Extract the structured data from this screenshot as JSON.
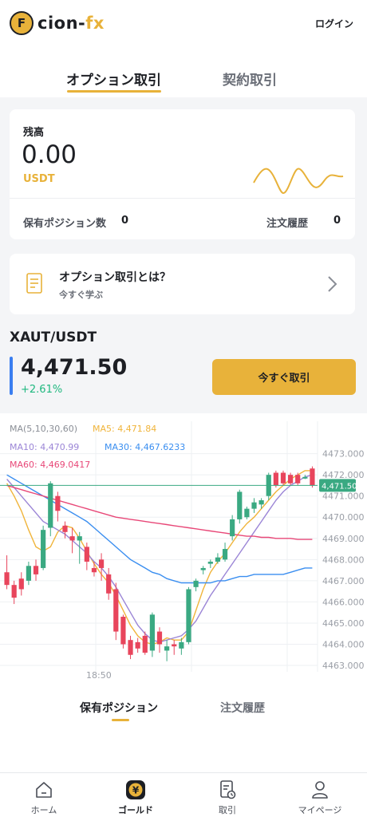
{
  "header": {
    "logo_mark": "F",
    "brand_main": "cion-",
    "brand_accent": "fx",
    "login_label": "ログイン"
  },
  "tabs": [
    {
      "label": "オプション取引",
      "active": true
    },
    {
      "label": "契約取引",
      "active": false
    }
  ],
  "balance": {
    "label": "残高",
    "value": "0.00",
    "unit": "USDT",
    "positions_label": "保有ポジション数",
    "positions_count": "0",
    "orders_label": "注文履歴",
    "orders_count": "0"
  },
  "learn": {
    "title": "オプション取引とは？",
    "subtitle": "今すぐ学ぶ",
    "icon": "document-icon"
  },
  "market": {
    "pair": "XAUT/USDT",
    "price": "4,471.50",
    "change": "+2.61%",
    "trade_label": "今すぐ取引"
  },
  "chart_data": {
    "type": "candlestick",
    "ma_legend": {
      "periods": "MA(5,10,30,60)",
      "ma5": "MA5: 4,471.84",
      "ma10": "MA10: 4,470.99",
      "ma30": "MA30: 4,467.6233",
      "ma60": "MA60: 4,469.0417"
    },
    "y_ticks": [
      4473.0,
      4472.0,
      4471.0,
      4470.0,
      4469.0,
      4468.0,
      4467.0,
      4466.0,
      4465.0,
      4464.0,
      4463.0
    ],
    "y_tick_labels": [
      "4473.000",
      "4472.000",
      "4471.000",
      "4470.000",
      "4469.000",
      "4468.000",
      "4467.000",
      "4466.000",
      "4465.000",
      "4464.000",
      "4463.000"
    ],
    "ylim": [
      4462.7,
      4473.4
    ],
    "x_label": "18:50",
    "current_price": 4471.5,
    "current_price_label": "4,471.50",
    "candles": [
      {
        "o": 4467.4,
        "h": 4468.2,
        "l": 4466.6,
        "c": 4466.8
      },
      {
        "o": 4466.8,
        "h": 4467.0,
        "l": 4465.9,
        "c": 4466.2
      },
      {
        "o": 4467.1,
        "h": 4467.4,
        "l": 4466.3,
        "c": 4466.6
      },
      {
        "o": 4467.0,
        "h": 4467.9,
        "l": 4466.8,
        "c": 4467.7
      },
      {
        "o": 4467.7,
        "h": 4468.0,
        "l": 4467.0,
        "c": 4467.3
      },
      {
        "o": 4467.6,
        "h": 4469.6,
        "l": 4467.5,
        "c": 4469.4
      },
      {
        "o": 4469.5,
        "h": 4471.7,
        "l": 4469.1,
        "c": 4471.6
      },
      {
        "o": 4471.0,
        "h": 4471.2,
        "l": 4469.8,
        "c": 4470.3
      },
      {
        "o": 4469.6,
        "h": 4469.8,
        "l": 4469.0,
        "c": 4469.3
      },
      {
        "o": 4469.1,
        "h": 4469.5,
        "l": 4468.3,
        "c": 4468.9
      },
      {
        "o": 4468.9,
        "h": 4469.3,
        "l": 4467.8,
        "c": 4469.1
      },
      {
        "o": 4468.6,
        "h": 4468.8,
        "l": 4467.5,
        "c": 4467.9
      },
      {
        "o": 4467.6,
        "h": 4467.9,
        "l": 4467.2,
        "c": 4467.4
      },
      {
        "o": 4468.0,
        "h": 4468.3,
        "l": 4467.0,
        "c": 4467.6
      },
      {
        "o": 4467.3,
        "h": 4467.6,
        "l": 4466.1,
        "c": 4466.4
      },
      {
        "o": 4466.6,
        "h": 4466.9,
        "l": 4464.2,
        "c": 4464.6
      },
      {
        "o": 4465.3,
        "h": 4465.4,
        "l": 4463.8,
        "c": 4464.0
      },
      {
        "o": 4464.2,
        "h": 4464.4,
        "l": 4463.3,
        "c": 4463.5
      },
      {
        "o": 4464.1,
        "h": 4464.3,
        "l": 4463.6,
        "c": 4463.8
      },
      {
        "o": 4464.4,
        "h": 4464.6,
        "l": 4463.5,
        "c": 4463.6
      },
      {
        "o": 4463.7,
        "h": 4465.5,
        "l": 4463.4,
        "c": 4465.4
      },
      {
        "o": 4464.6,
        "h": 4464.8,
        "l": 4463.6,
        "c": 4464.0
      },
      {
        "o": 4463.7,
        "h": 4464.2,
        "l": 4463.2,
        "c": 4463.9
      },
      {
        "o": 4464.0,
        "h": 4464.2,
        "l": 4463.5,
        "c": 4463.9
      },
      {
        "o": 4463.8,
        "h": 4464.3,
        "l": 4463.5,
        "c": 4464.1
      },
      {
        "o": 4464.1,
        "h": 4466.7,
        "l": 4464.0,
        "c": 4466.6
      },
      {
        "o": 4466.7,
        "h": 4467.1,
        "l": 4466.5,
        "c": 4467.0
      },
      {
        "o": 4467.5,
        "h": 4467.7,
        "l": 4467.3,
        "c": 4467.6
      },
      {
        "o": 4467.8,
        "h": 4468.0,
        "l": 4467.6,
        "c": 4467.9
      },
      {
        "o": 4467.9,
        "h": 4468.3,
        "l": 4467.8,
        "c": 4468.1
      },
      {
        "o": 4468.0,
        "h": 4468.8,
        "l": 4467.9,
        "c": 4468.5
      },
      {
        "o": 4469.1,
        "h": 4470.1,
        "l": 4468.9,
        "c": 4469.9
      },
      {
        "o": 4469.9,
        "h": 4471.3,
        "l": 4469.7,
        "c": 4471.2
      },
      {
        "o": 4470.0,
        "h": 4470.5,
        "l": 4469.9,
        "c": 4470.4
      },
      {
        "o": 4470.4,
        "h": 4470.9,
        "l": 4470.2,
        "c": 4470.7
      },
      {
        "o": 4470.6,
        "h": 4470.9,
        "l": 4470.4,
        "c": 4470.8
      },
      {
        "o": 4471.0,
        "h": 4472.1,
        "l": 4470.8,
        "c": 4472.0
      },
      {
        "o": 4472.1,
        "h": 4472.2,
        "l": 4471.4,
        "c": 4471.5
      },
      {
        "o": 4472.1,
        "h": 4472.2,
        "l": 4471.5,
        "c": 4471.6
      },
      {
        "o": 4472.0,
        "h": 4472.1,
        "l": 4471.5,
        "c": 4471.6
      },
      {
        "o": 4472.0,
        "h": 4472.1,
        "l": 4471.5,
        "c": 4471.6
      },
      {
        "o": 4471.9,
        "h": 4472.0,
        "l": 4471.8,
        "c": 4471.9
      },
      {
        "o": 4472.3,
        "h": 4472.4,
        "l": 4471.4,
        "c": 4471.5
      }
    ],
    "series": [
      {
        "id": "ma5",
        "values": [
          4471.6,
          4471.0,
          4470.3,
          4469.4,
          4468.6,
          4468.4,
          4468.6,
          4469.3,
          4469.6,
          4469.5,
          4469.0,
          4468.4,
          4467.8,
          4467.3,
          4466.9,
          4466.3,
          4465.6,
          4464.9,
          4464.4,
          4464.1,
          4464.0,
          4464.1,
          4464.3,
          4464.2,
          4464.2,
          4464.6,
          4465.6,
          4466.6,
          4467.4,
          4467.9,
          4468.3,
          4468.8,
          4469.3,
          4469.7,
          4470.0,
          4470.4,
          4470.8,
          4471.2,
          4471.5,
          4471.8,
          4472.0,
          4472.2,
          4472.2
        ]
      },
      {
        "id": "ma10",
        "values": [
          4471.8,
          4471.4,
          4471.0,
          4470.6,
          4470.2,
          4469.8,
          4469.6,
          4469.4,
          4469.2,
          4468.9,
          4468.6,
          4468.3,
          4467.9,
          4467.6,
          4467.2,
          4466.7,
          4466.1,
          4465.5,
          4464.9,
          4464.5,
          4464.2,
          4464.1,
          4464.2,
          4464.3,
          4464.4,
          4464.7,
          4465.1,
          4465.7,
          4466.3,
          4466.8,
          4467.3,
          4467.8,
          4468.3,
          4468.8,
          4469.3,
          4469.8,
          4470.3,
          4470.8,
          4471.2,
          4471.5,
          4471.7,
          4471.9,
          4472.0
        ]
      },
      {
        "id": "ma30",
        "values": [
          4472.0,
          4471.8,
          4471.6,
          4471.4,
          4471.2,
          4471.0,
          4470.8,
          4470.6,
          4470.4,
          4470.2,
          4470.0,
          4469.8,
          4469.5,
          4469.2,
          4468.9,
          4468.6,
          4468.3,
          4468.0,
          4467.8,
          4467.6,
          4467.4,
          4467.3,
          4467.1,
          4467.0,
          4466.9,
          4466.9,
          4466.9,
          4466.9,
          4466.9,
          4467.0,
          4467.0,
          4467.1,
          4467.2,
          4467.2,
          4467.3,
          4467.3,
          4467.3,
          4467.3,
          4467.3,
          4467.4,
          4467.5,
          4467.6,
          4467.6
        ]
      },
      {
        "id": "ma60",
        "values": [
          4471.5,
          4471.4,
          4471.3,
          4471.2,
          4471.1,
          4471.0,
          4470.9,
          4470.8,
          4470.7,
          4470.6,
          4470.5,
          4470.4,
          4470.3,
          4470.2,
          4470.1,
          4470.0,
          4469.95,
          4469.9,
          4469.85,
          4469.8,
          4469.75,
          4469.7,
          4469.65,
          4469.6,
          4469.55,
          4469.5,
          4469.45,
          4469.4,
          4469.35,
          4469.3,
          4469.25,
          4469.2,
          4469.15,
          4469.1,
          4469.1,
          4469.05,
          4469.05,
          4469.0,
          4469.0,
          4469.0,
          4468.95,
          4468.95,
          4468.95
        ]
      }
    ],
    "colors": {
      "up": "#3aa982",
      "down": "#e8455c",
      "ma5": "#f0b43a",
      "ma10": "#9b85d6",
      "ma30": "#3a8ef0",
      "ma60": "#e84878",
      "price_line": "#3aa982"
    }
  },
  "lower_tabs": [
    {
      "label": "保有ポジション",
      "active": true
    },
    {
      "label": "注文履歴",
      "active": false
    }
  ],
  "nav": [
    {
      "label": "ホーム",
      "icon": "home-icon",
      "active": false
    },
    {
      "label": "ゴールド",
      "icon": "yen-coin-icon",
      "active": true
    },
    {
      "label": "取引",
      "icon": "order-doc-icon",
      "active": false
    },
    {
      "label": "マイページ",
      "icon": "user-icon",
      "active": false
    }
  ],
  "colors": {
    "accent": "#e8b23a",
    "positive": "#1fb87f",
    "price_marker": "#3a7ef0"
  }
}
